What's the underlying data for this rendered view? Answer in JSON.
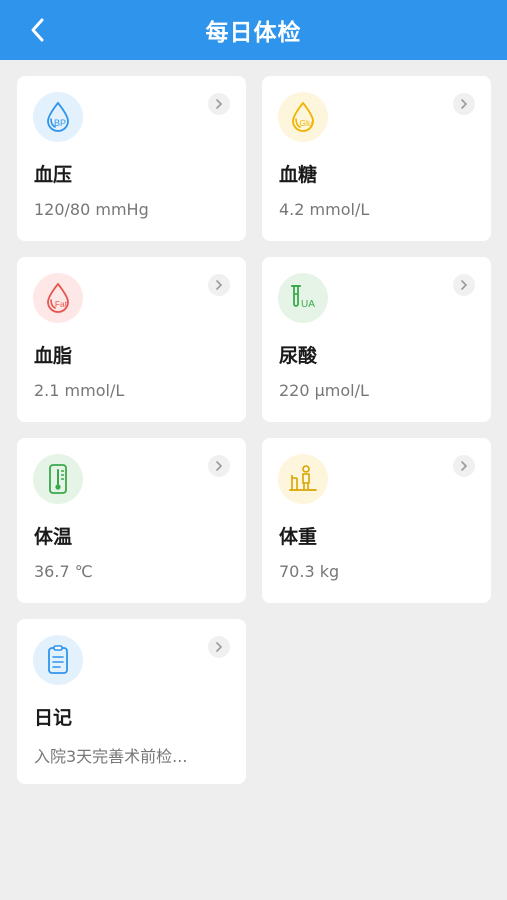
{
  "header": {
    "title": "每日体检",
    "back_icon": "chevron-left-icon"
  },
  "colors": {
    "header_bg": "#2f94ec",
    "bp": "#2f94ec",
    "glu": "#f0b400",
    "fat": "#e8554e",
    "ua": "#3aa84a",
    "temp": "#3aa84a",
    "weight": "#d9a300",
    "diary": "#2f94ec"
  },
  "cards": [
    {
      "title": "血压",
      "value": "120/80 mmHg",
      "icon": "blood-pressure-drop-icon",
      "icon_text": "BP"
    },
    {
      "title": "血糖",
      "value": "4.2 mmol/L",
      "icon": "blood-glucose-drop-icon",
      "icon_text": "Glu"
    },
    {
      "title": "血脂",
      "value": "2.1 mmol/L",
      "icon": "blood-fat-drop-icon",
      "icon_text": "Fat"
    },
    {
      "title": "尿酸",
      "value": "220 μmol/L",
      "icon": "uric-acid-tube-icon",
      "icon_text": "UA"
    },
    {
      "title": "体温",
      "value": "36.7 ℃",
      "icon": "thermometer-icon"
    },
    {
      "title": "体重",
      "value": "70.3 kg",
      "icon": "weight-scale-icon"
    },
    {
      "title": "日记",
      "value": "入院3天完善术前检...",
      "icon": "diary-note-icon"
    }
  ]
}
